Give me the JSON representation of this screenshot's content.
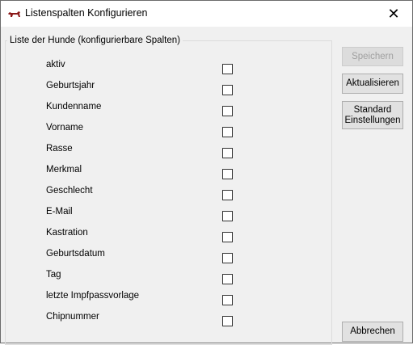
{
  "window": {
    "title": "Listenspalten Konfigurieren",
    "close_glyph": "✕",
    "app_icon": "dog-icon"
  },
  "group": {
    "legend": "Liste der Hunde (konfigurierbare Spalten)",
    "items": [
      {
        "label": "aktiv",
        "checked": false
      },
      {
        "label": "Geburtsjahr",
        "checked": false
      },
      {
        "label": "Kundenname",
        "checked": false
      },
      {
        "label": "Vorname",
        "checked": false
      },
      {
        "label": "Rasse",
        "checked": false
      },
      {
        "label": "Merkmal",
        "checked": false
      },
      {
        "label": "Geschlecht",
        "checked": false
      },
      {
        "label": "E-Mail",
        "checked": false
      },
      {
        "label": "Kastration",
        "checked": false
      },
      {
        "label": "Geburtsdatum",
        "checked": false
      },
      {
        "label": "Tag",
        "checked": false
      },
      {
        "label": "letzte Impfpassvorlage",
        "checked": false
      },
      {
        "label": "Chipnummer",
        "checked": false
      }
    ]
  },
  "buttons": {
    "save": "Speichern",
    "refresh": "Aktualisieren",
    "defaults_line1": "Standard",
    "defaults_line2": "Einstellungen",
    "cancel": "Abbrechen"
  }
}
